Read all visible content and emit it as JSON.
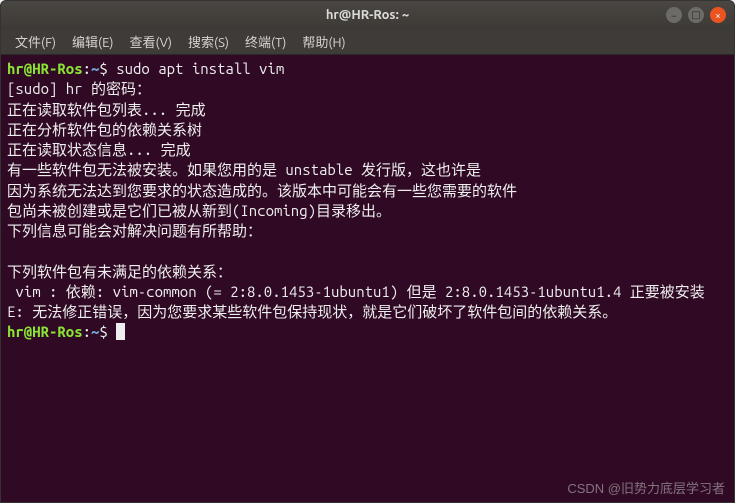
{
  "titlebar": {
    "title": "hr@HR-Ros: ~"
  },
  "window_controls": {
    "min": "−",
    "max": "□",
    "close": "×"
  },
  "menubar": {
    "file": "文件(F)",
    "edit": "编辑(E)",
    "view": "查看(V)",
    "search": "搜索(S)",
    "terminal": "终端(T)",
    "help": "帮助(H)"
  },
  "terminal": {
    "prompt_user_host": "hr@HR-Ros",
    "prompt_colon": ":",
    "prompt_path": "~",
    "prompt_dollar": "$ ",
    "cmd1": "sudo apt install vim",
    "lines": {
      "l1": "[sudo] hr 的密码：",
      "l2": "正在读取软件包列表... 完成",
      "l3": "正在分析软件包的依赖关系树",
      "l4": "正在读取状态信息... 完成",
      "l5": "有一些软件包无法被安装。如果您用的是 unstable 发行版，这也许是",
      "l6": "因为系统无法达到您要求的状态造成的。该版本中可能会有一些您需要的软件",
      "l7": "包尚未被创建或是它们已被从新到(Incoming)目录移出。",
      "l8": "下列信息可能会对解决问题有所帮助：",
      "l9": "",
      "l10": "下列软件包有未满足的依赖关系：",
      "l11": " vim : 依赖: vim-common (= 2:8.0.1453-1ubuntu1) 但是 2:8.0.1453-1ubuntu1.4 正要被安装",
      "l12": "E: 无法修正错误，因为您要求某些软件包保持现状，就是它们破坏了软件包间的依赖关系。"
    }
  },
  "watermark": "CSDN @旧势力底层学习者"
}
